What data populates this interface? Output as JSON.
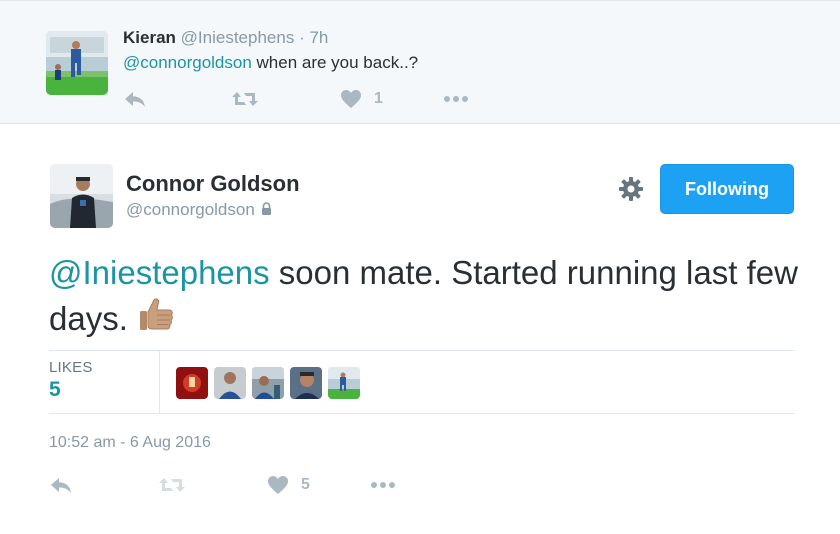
{
  "reply": {
    "name": "Kieran",
    "handle": "@Iniestephens",
    "time": "· 7h",
    "mention": "@connorgoldson",
    "text": " when are you back..?",
    "like_count": "1",
    "icons": [
      "reply-icon",
      "retweet-icon",
      "heart-icon",
      "more-icon"
    ]
  },
  "tweet": {
    "author_name": "Connor Goldson",
    "author_handle": "@connorgoldson",
    "follow_label": "Following",
    "mention": "@Iniestephens",
    "text": " soon mate. Started running last few days.",
    "emoji": "thumbs-up-icon",
    "likes_label": "LIKES",
    "likes_count": "5",
    "timestamp": "10:52 am - 6 Aug 2016",
    "action_like_count": "5"
  },
  "colors": {
    "accent_blue": "#1da1f2",
    "mention_teal": "#1b95a3",
    "muted": "#8899a6",
    "icon_grey": "#aab8c2",
    "reply_bg": "#f5f8fa"
  }
}
